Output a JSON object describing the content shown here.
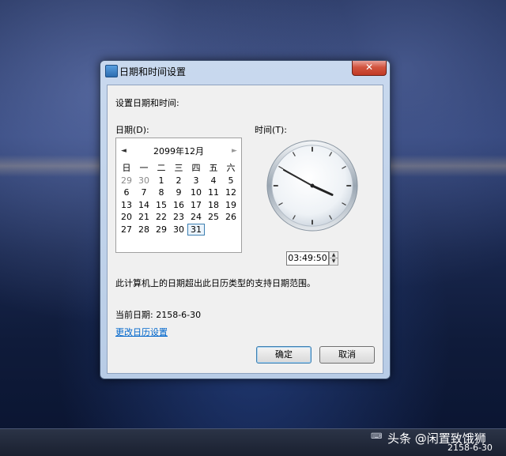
{
  "window": {
    "title": "日期和时间设置",
    "close_label": "✕"
  },
  "dialog": {
    "instruction": "设置日期和时间:",
    "date_label": "日期(D):",
    "time_label": "时间(T):",
    "warning": "此计算机上的日期超出此日历类型的支持日期范围。",
    "current_date": "当前日期: 2158-6-30",
    "change_calendar_link": "更改日历设置",
    "ok_label": "确定",
    "cancel_label": "取消"
  },
  "calendar": {
    "month_title": "2099年12月",
    "prev_glyph": "◄",
    "next_glyph": "►",
    "weekdays": [
      "日",
      "一",
      "二",
      "三",
      "四",
      "五",
      "六"
    ],
    "weeks": [
      [
        "29",
        "30",
        "1",
        "2",
        "3",
        "4",
        "5"
      ],
      [
        "6",
        "7",
        "8",
        "9",
        "10",
        "11",
        "12"
      ],
      [
        "13",
        "14",
        "15",
        "16",
        "17",
        "18",
        "19"
      ],
      [
        "20",
        "21",
        "22",
        "23",
        "24",
        "25",
        "26"
      ],
      [
        "27",
        "28",
        "29",
        "30",
        "31",
        "",
        ""
      ]
    ],
    "other_month_days": [
      "29",
      "30"
    ],
    "selected_day": "31"
  },
  "clock": {
    "time": "03:49:50",
    "hour": 3,
    "minute": 49,
    "second": 50
  },
  "taskbar": {
    "watermark": "头条 @闲置致饿狮",
    "date": "2158-6-30",
    "tray_icon": "keyboard-icon"
  }
}
